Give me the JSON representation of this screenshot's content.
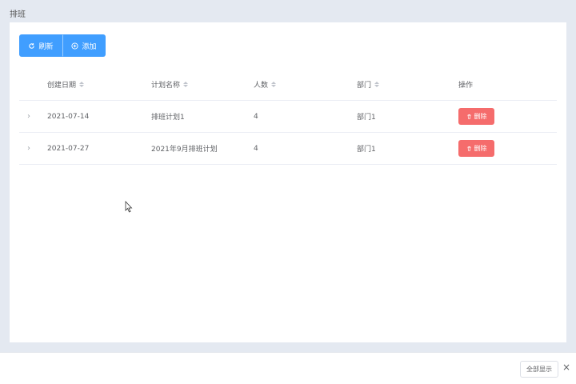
{
  "page": {
    "title": "排班"
  },
  "toolbar": {
    "refresh_label": "刷新",
    "add_label": "添加",
    "accent": "#409eff"
  },
  "table": {
    "columns": [
      "创建日期",
      "计划名称",
      "人数",
      "部门",
      "操作"
    ],
    "rows": [
      {
        "date": "2021-07-14",
        "name": "排班计划1",
        "count": "4",
        "dept": "部门1",
        "action": "删除"
      },
      {
        "date": "2021-07-27",
        "name": "2021年9月排班计划",
        "count": "4",
        "dept": "部门1",
        "action": "删除"
      }
    ],
    "delete_color": "#f56c6c"
  },
  "footer": {
    "show_all_label": "全部显示",
    "close_glyph": "×"
  },
  "icons": {
    "refresh": "refresh-icon",
    "add": "plus-circle-icon",
    "delete": "trash-icon",
    "expand": "chevron-right-icon",
    "sort": "sort-caret-icon"
  }
}
